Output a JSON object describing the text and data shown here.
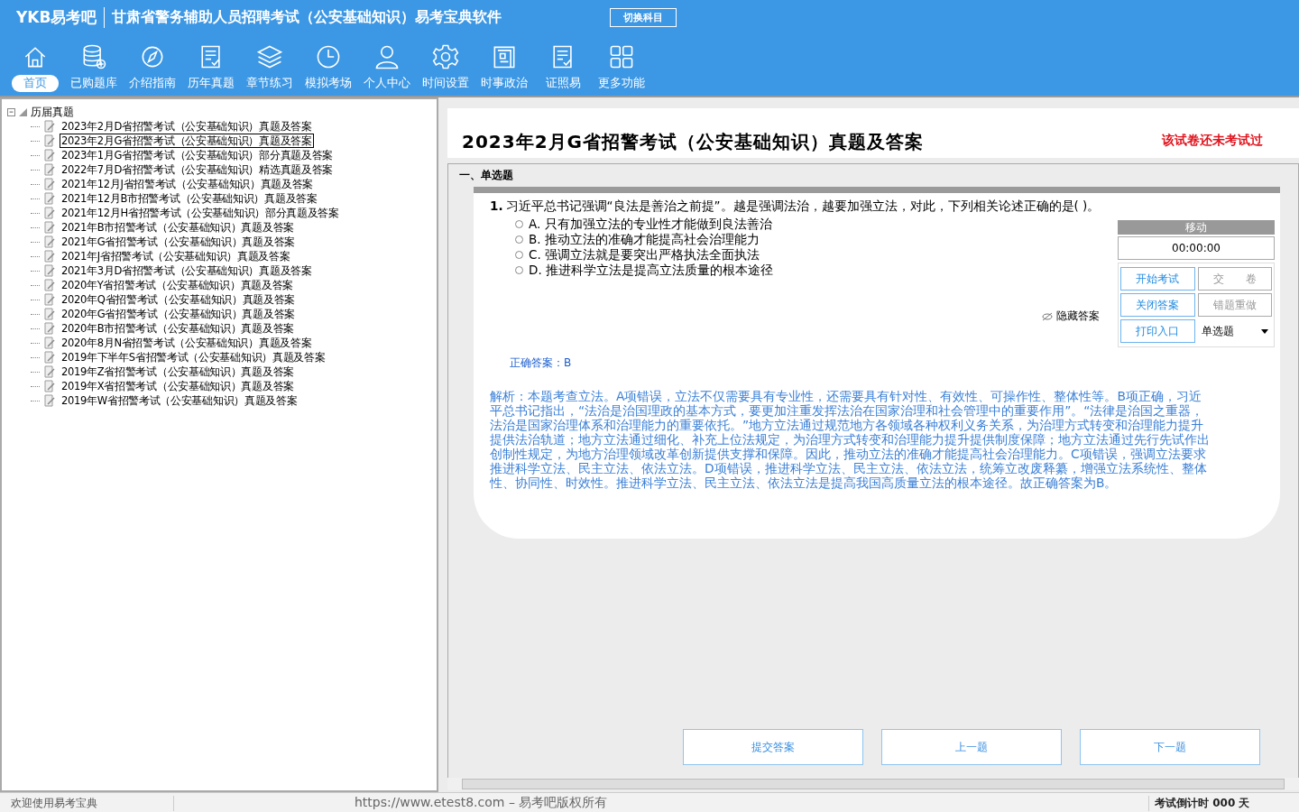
{
  "header": {
    "logo": "YKB易考吧",
    "title": "甘肃省警务辅助人员招聘考试（公安基础知识）易考宝典软件",
    "switch_button": "切换科目"
  },
  "nav": [
    {
      "label": "首页",
      "selected": true
    },
    {
      "label": "已购题库",
      "selected": false
    },
    {
      "label": "介绍指南",
      "selected": false
    },
    {
      "label": "历年真题",
      "selected": false
    },
    {
      "label": "章节练习",
      "selected": false
    },
    {
      "label": "模拟考场",
      "selected": false
    },
    {
      "label": "个人中心",
      "selected": false
    },
    {
      "label": "时间设置",
      "selected": false
    },
    {
      "label": "时事政治",
      "selected": false
    },
    {
      "label": "证照易",
      "selected": false
    },
    {
      "label": "更多功能",
      "selected": false
    }
  ],
  "tree": {
    "label": "历届真题",
    "expanded": true,
    "children": [
      {
        "label": "2023年2月D省招警考试（公安基础知识）真题及答案",
        "selected": false
      },
      {
        "label": "2023年2月G省招警考试（公安基础知识）真题及答案",
        "selected": true
      },
      {
        "label": "2023年1月G省招警考试（公安基础知识）部分真题及答案",
        "selected": false
      },
      {
        "label": "2022年7月D省招警考试（公安基础知识）精选真题及答案",
        "selected": false
      },
      {
        "label": "2021年12月J省招警考试（公安基础知识）真题及答案",
        "selected": false
      },
      {
        "label": "2021年12月B市招警考试（公安基础知识）真题及答案",
        "selected": false
      },
      {
        "label": "2021年12月H省招警考试（公安基础知识）部分真题及答案",
        "selected": false
      },
      {
        "label": "2021年B市招警考试（公安基础知识）真题及答案",
        "selected": false
      },
      {
        "label": "2021年G省招警考试（公安基础知识）真题及答案",
        "selected": false
      },
      {
        "label": "2021年J省招警考试（公安基础知识）真题及答案",
        "selected": false
      },
      {
        "label": "2021年3月D省招警考试（公安基础知识）真题及答案",
        "selected": false
      },
      {
        "label": "2020年Y省招警考试（公安基础知识）真题及答案",
        "selected": false
      },
      {
        "label": "2020年Q省招警考试（公安基础知识）真题及答案",
        "selected": false
      },
      {
        "label": "2020年G省招警考试（公安基础知识）真题及答案",
        "selected": false
      },
      {
        "label": "2020年B市招警考试（公安基础知识）真题及答案",
        "selected": false
      },
      {
        "label": "2020年8月N省招警考试（公安基础知识）真题及答案",
        "selected": false
      },
      {
        "label": "2019年下半年S省招警考试（公安基础知识）真题及答案",
        "selected": false
      },
      {
        "label": "2019年Z省招警考试（公安基础知识）真题及答案",
        "selected": false
      },
      {
        "label": "2019年X省招警考试（公安基础知识）真题及答案",
        "selected": false
      },
      {
        "label": "2019年W省招警考试（公安基础知识）真题及答案",
        "selected": false
      }
    ]
  },
  "exam": {
    "title": "2023年2月G省招警考试（公安基础知识）真题及答案",
    "status": "该试卷还未考试过",
    "section": "一、单选题"
  },
  "question": {
    "number": "1.",
    "text": "习近平总书记强调“良法是善治之前提”。越是强调法治，越要加强立法，对此，下列相关论述正确的是( )。",
    "options": [
      {
        "label": "A. 只有加强立法的专业性才能做到良法善治",
        "selected": false
      },
      {
        "label": "B. 推动立法的准确才能提高社会治理能力",
        "selected": false
      },
      {
        "label": "C. 强调立法就是要突出严格执法全面执法",
        "selected": false
      },
      {
        "label": "D. 推进科学立法是提高立法质量的根本途径",
        "selected": false
      }
    ],
    "answer": "正确答案：B",
    "explanation": "解析：本题考查立法。A项错误，立法不仅需要具有专业性，还需要具有针对性、有效性、可操作性、整体性等。B项正确，习近平总书记指出，“法治是治国理政的基本方式，要更加注重发挥法治在国家治理和社会管理中的重要作用”。“法律是治国之重器，法治是国家治理体系和治理能力的重要依托。”地方立法通过规范地方各领域各种权利义务关系，为治理方式转变和治理能力提升提供法治轨道；地方立法通过细化、补充上位法规定，为治理方式转变和治理能力提升提供制度保障；地方立法通过先行先试作出创制性规定，为地方治理领域改革创新提供支撑和保障。因此，推动立法的准确才能提高社会治理能力。C项错误，强调立法要求推进科学立法、民主立法、依法立法。D项错误，推进科学立法、民主立法、依法立法，统筹立改废释纂，增强立法系统性、整体性、协同性、时效性。推进科学立法、民主立法、依法立法是提高我国高质量立法的根本途径。故正确答案为B。"
  },
  "panel": {
    "title": "移动",
    "timer": "00:00:00",
    "hide_answer": "隐藏答案",
    "buttons": [
      "开始考试",
      "交　　卷",
      "关闭答案",
      "错题重做",
      "打印入口"
    ],
    "type_select": "单选题"
  },
  "actions": [
    "提交答案",
    "上一题",
    "下一题"
  ],
  "status_bar": {
    "welcome": "欢迎使用易考宝典",
    "copyright": "https://www.etest8.com – 易考吧版权所有",
    "countdown": "考试倒计时 000 天"
  }
}
